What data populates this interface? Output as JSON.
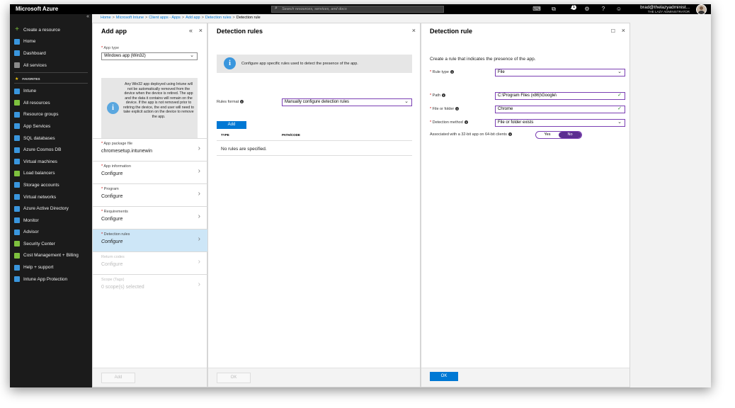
{
  "topbar": {
    "brand": "Microsoft Azure",
    "search_placeholder": "Search resources, services, and docs",
    "notification_count": "1",
    "user_email": "brad@thelazyadminist...",
    "user_role": "THE LAZY ADMINISTRATOR",
    "icons": [
      "cloud-shell-icon",
      "directory-filter-icon",
      "notifications-icon",
      "settings-icon",
      "help-icon",
      "feedback-icon"
    ]
  },
  "sidebar": {
    "collapse": "«",
    "create": "Create a resource",
    "favorites_label": "FAVORITES",
    "top_items": [
      {
        "label": "Home",
        "color": "#3a96dd"
      },
      {
        "label": "Dashboard",
        "color": "#3a96dd"
      },
      {
        "label": "All services",
        "color": "#8a8a8a"
      }
    ],
    "items": [
      {
        "label": "Intune",
        "color": "#3a96dd"
      },
      {
        "label": "All resources",
        "color": "#7ec13e"
      },
      {
        "label": "Resource groups",
        "color": "#3a96dd"
      },
      {
        "label": "App Services",
        "color": "#3a96dd"
      },
      {
        "label": "SQL databases",
        "color": "#3a96dd"
      },
      {
        "label": "Azure Cosmos DB",
        "color": "#3a96dd"
      },
      {
        "label": "Virtual machines",
        "color": "#3a96dd"
      },
      {
        "label": "Load balancers",
        "color": "#7ec13e"
      },
      {
        "label": "Storage accounts",
        "color": "#3a96dd"
      },
      {
        "label": "Virtual networks",
        "color": "#3a96dd"
      },
      {
        "label": "Azure Active Directory",
        "color": "#3a96dd"
      },
      {
        "label": "Monitor",
        "color": "#3a96dd"
      },
      {
        "label": "Advisor",
        "color": "#3a96dd"
      },
      {
        "label": "Security Center",
        "color": "#7ec13e"
      },
      {
        "label": "Cost Management + Billing",
        "color": "#7ec13e"
      },
      {
        "label": "Help + support",
        "color": "#3a96dd"
      },
      {
        "label": "Intune App Protection",
        "color": "#3a96dd"
      }
    ]
  },
  "breadcrumb": {
    "items": [
      "Home",
      "Microsoft Intune",
      "Client apps - Apps",
      "Add app",
      "Detection rules"
    ],
    "current": "Detection rule",
    "separator": ">"
  },
  "add_app": {
    "title": "Add app",
    "collapse": "«",
    "close": "×",
    "app_type_label": "App type",
    "app_type_value": "Windows app (Win32)",
    "info_text": "Any Win32 app deployed using Intune will not be automatically removed from the device when the device is retired. The app and the data it contains will remain on the device. If the app is not removed prior to retiring the device, the end user will need to take explicit action on the device to remove the app.",
    "steps": [
      {
        "label": "App package file",
        "value": "chromesetup.intunewin",
        "required": true,
        "state": "normal"
      },
      {
        "label": "App information",
        "value": "Configure",
        "required": true,
        "state": "normal"
      },
      {
        "label": "Program",
        "value": "Configure",
        "required": true,
        "state": "normal"
      },
      {
        "label": "Requirements",
        "value": "Configure",
        "required": true,
        "state": "normal"
      },
      {
        "label": "Detection rules",
        "value": "Configure",
        "required": true,
        "state": "selected"
      },
      {
        "label": "Return codes",
        "value": "Configure",
        "required": false,
        "state": "disabled"
      },
      {
        "label": "Scope (Tags)",
        "value": "0 scope(s) selected",
        "required": false,
        "state": "disabled"
      }
    ],
    "footer_button": "Add"
  },
  "detection_rules": {
    "title": "Detection rules",
    "close": "×",
    "banner": "Configure app specific rules used to detect the presence of the app.",
    "rules_format_label": "Rules format",
    "rules_format_value": "Manually configure detection rules",
    "add_button": "Add",
    "col_type": "TYPE",
    "col_path": "PATH/CODE",
    "empty_text": "No rules are specified.",
    "footer_button": "OK"
  },
  "detection_rule": {
    "title": "Detection rule",
    "maximize": "☐",
    "close": "×",
    "intro": "Create a rule that indicates the presence of the app.",
    "rule_type_label": "Rule type",
    "rule_type_value": "File",
    "path_label": "Path",
    "path_value": "C:\\Program Files (x86)\\Google\\",
    "file_label": "File or folder",
    "file_value": "Chrome",
    "method_label": "Detection method",
    "method_value": "File or folder exists",
    "assoc_label": "Associated with a 32-bit app on 64-bit clients",
    "toggle_yes": "Yes",
    "toggle_no": "No",
    "toggle_selected": "No",
    "footer_button": "OK"
  }
}
